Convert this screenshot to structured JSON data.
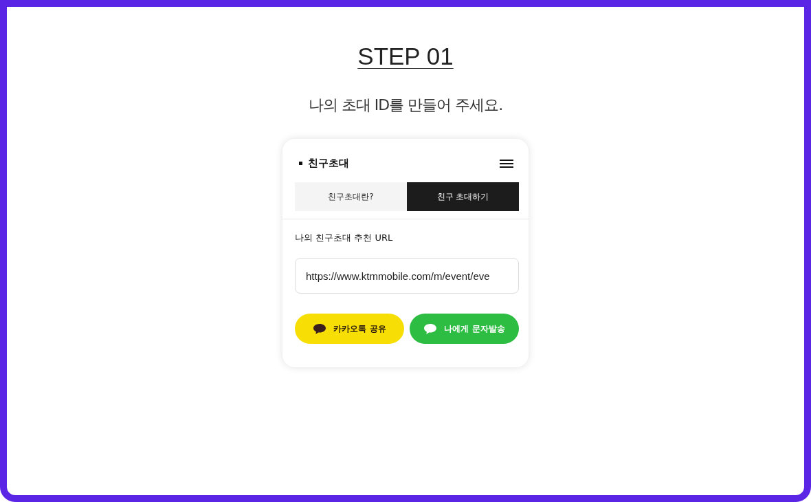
{
  "step": {
    "title": "STEP 01",
    "subtitle": "나의 초대 ID를 만들어 주세요."
  },
  "card": {
    "title": "친구초대",
    "tabs": [
      {
        "label": "친구초대란?",
        "selected": false
      },
      {
        "label": "친구 초대하기",
        "selected": true
      }
    ],
    "url_label": "나의 친구초대 추천 URL",
    "url_field": {
      "value": "https://www.ktmmobile.com/m/event/eve"
    },
    "buttons": [
      {
        "kind": "kakao",
        "label": "카카오톡 공유"
      },
      {
        "kind": "sms",
        "label": "나에게 문자발송"
      }
    ]
  }
}
